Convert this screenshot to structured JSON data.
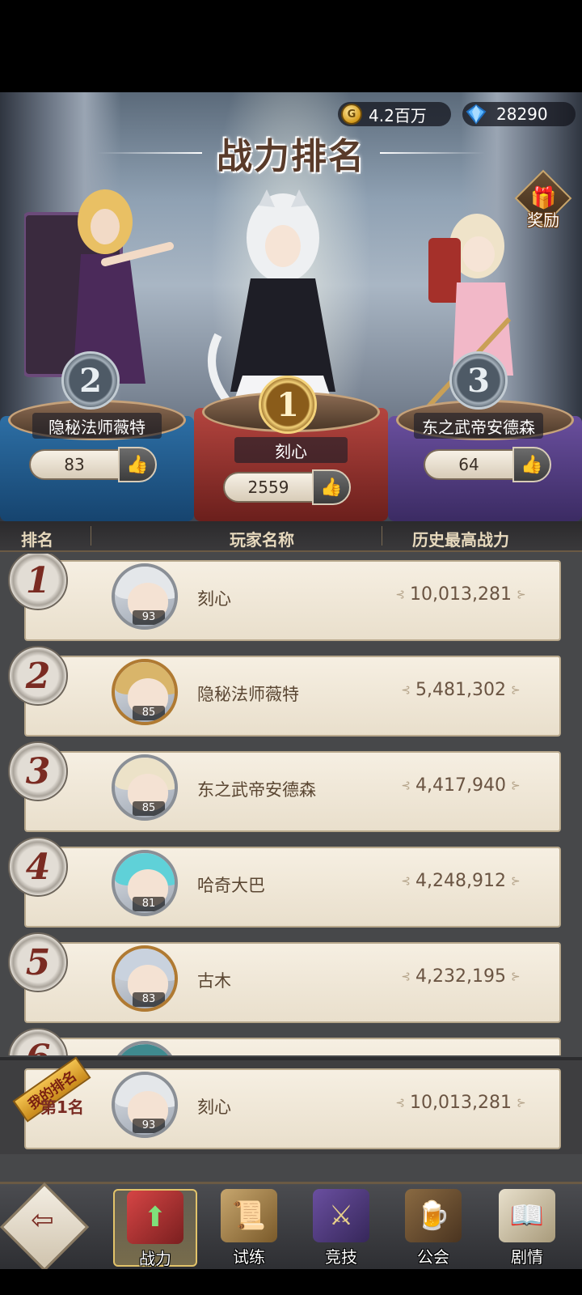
{
  "currency": {
    "gold": "4.2百万",
    "gold_icon_glyph": "G",
    "gems": "28290"
  },
  "header": {
    "title": "战力排名",
    "reward_label": "奖励"
  },
  "podium": [
    {
      "rank": "2",
      "name": "隐秘法师薇特",
      "likes": "83"
    },
    {
      "rank": "1",
      "name": "刻心",
      "likes": "2559"
    },
    {
      "rank": "3",
      "name": "东之武帝安德森",
      "likes": "64"
    }
  ],
  "columns": {
    "rank": "排名",
    "player": "玩家名称",
    "power": "历史最高战力"
  },
  "rows": [
    {
      "rank": "1",
      "name": "刻心",
      "level": "93",
      "power": "10,013,281"
    },
    {
      "rank": "2",
      "name": "隐秘法师薇特",
      "level": "85",
      "power": "5,481,302"
    },
    {
      "rank": "3",
      "name": "东之武帝安德森",
      "level": "85",
      "power": "4,417,940"
    },
    {
      "rank": "4",
      "name": "哈奇大巴",
      "level": "81",
      "power": "4,248,912"
    },
    {
      "rank": "5",
      "name": "古木",
      "level": "83",
      "power": "4,232,195"
    },
    {
      "rank": "6",
      "name": "",
      "level": "",
      "power": ""
    }
  ],
  "my_rank": {
    "ribbon": "我的排名",
    "rank_text": "第1名",
    "name": "刻心",
    "level": "93",
    "power": "10,013,281"
  },
  "nav": {
    "power": "战力",
    "trial": "试练",
    "arena": "竞技",
    "guild": "公会",
    "story": "剧情"
  }
}
